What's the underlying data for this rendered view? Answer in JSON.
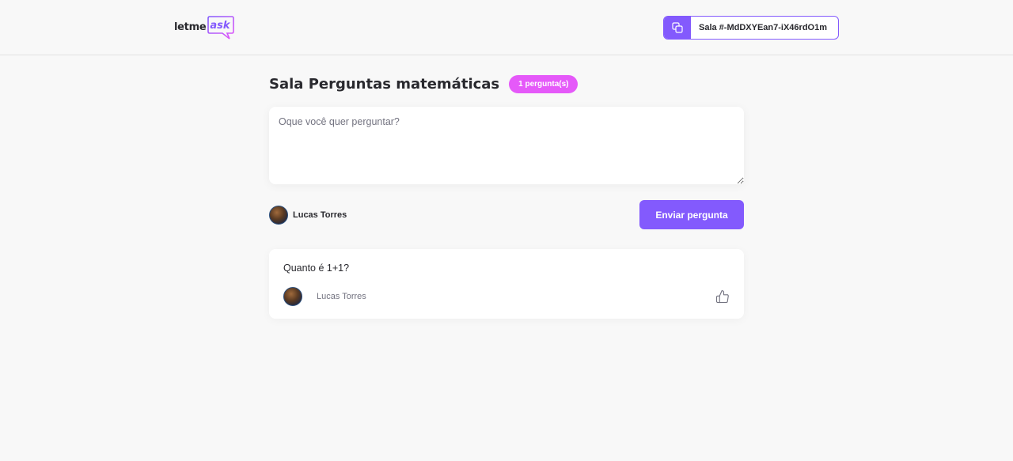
{
  "header": {
    "logo": {
      "part1": "letme",
      "part2": "ask"
    },
    "room_code": {
      "label": "Sala #-MdDXYEan7-iX46rdO1m"
    }
  },
  "room": {
    "title": "Sala Perguntas matemáticas",
    "count_badge": "1 pergunta(s)"
  },
  "form": {
    "placeholder": "Oque você quer perguntar?",
    "user_name": "Lucas Torres",
    "submit_label": "Enviar pergunta"
  },
  "questions": [
    {
      "content": "Quanto é 1+1?",
      "author": "Lucas Torres"
    }
  ],
  "colors": {
    "primary": "#835afd",
    "badge": "#e559f9",
    "background": "#f8f8f8"
  },
  "icons": [
    "copy-icon",
    "like-icon"
  ]
}
